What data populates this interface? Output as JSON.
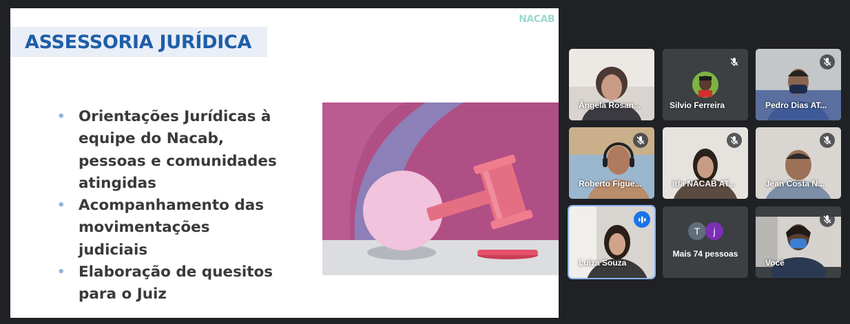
{
  "slide": {
    "logo": "NACAB",
    "title": "ASSESSORIA JURÍDICA",
    "bullets": [
      "Orientações Jurídicas à equipe do Nacab, pessoas e comunidades atingidas",
      "Acompanhamento das movimentações judiciais",
      "Elaboração de quesitos para o Juiz"
    ],
    "colors": {
      "title": "#1f5ea8",
      "bullet_text": "#3a3a3a",
      "bullet_dot": "#8fb3d9",
      "illustration_bg": "#b04f86"
    }
  },
  "participants": [
    {
      "name": "Ângela Rosan...",
      "muted": false,
      "speaking": false
    },
    {
      "name": "Silvio Ferreira",
      "muted": true,
      "speaking": false
    },
    {
      "name": "Pedro Dias AT...",
      "muted": true,
      "speaking": false
    },
    {
      "name": "Roberto Figue...",
      "muted": true,
      "speaking": false
    },
    {
      "name": "Irla NACAB AT...",
      "muted": true,
      "speaking": false
    },
    {
      "name": "Jean Costa N...",
      "muted": true,
      "speaking": false
    },
    {
      "name": "Luiza Souza",
      "muted": false,
      "speaking": true
    },
    {
      "name": "Você",
      "muted": true,
      "speaking": false
    }
  ],
  "more": {
    "label": "Mais 74 pessoas",
    "avatars": [
      {
        "initial": "T",
        "color": "#5f6e79"
      },
      {
        "initial": "j",
        "color": "#7b2fb5"
      }
    ]
  }
}
